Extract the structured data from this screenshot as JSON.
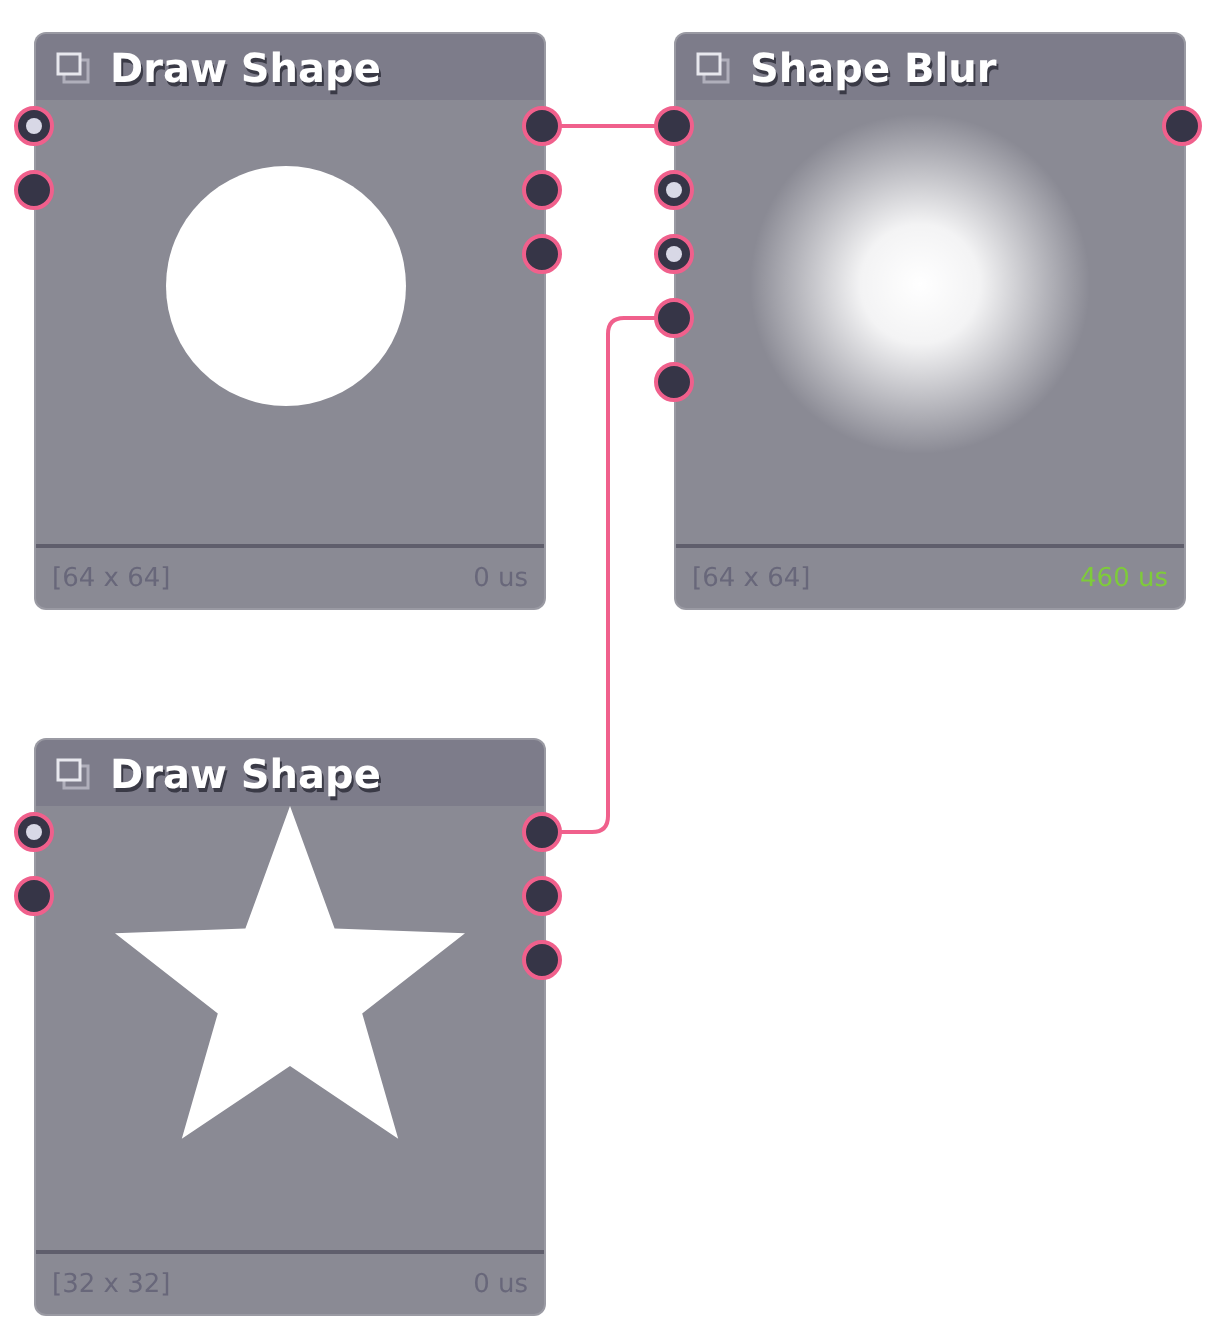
{
  "nodes": [
    {
      "title": "Draw Shape",
      "kind": "circle",
      "inputs": [
        {
          "filled": true,
          "connected": false
        },
        {
          "filled": false,
          "connected": false
        }
      ],
      "outputs": [
        {
          "filled": false,
          "connected": true
        },
        {
          "filled": false,
          "connected": false
        },
        {
          "filled": false,
          "connected": false
        }
      ],
      "size": "[64 x 64]",
      "time": "0 us",
      "time_highlighted": false
    },
    {
      "title": "Shape Blur",
      "kind": "blur",
      "inputs": [
        {
          "filled": false,
          "connected": true
        },
        {
          "filled": true,
          "connected": false
        },
        {
          "filled": true,
          "connected": false
        },
        {
          "filled": false,
          "connected": true
        },
        {
          "filled": false,
          "connected": false
        }
      ],
      "outputs": [
        {
          "filled": false,
          "connected": false
        }
      ],
      "size": "[64 x 64]",
      "time": "460 us",
      "time_highlighted": true
    },
    {
      "title": "Draw Shape",
      "kind": "star",
      "inputs": [
        {
          "filled": true,
          "connected": false
        },
        {
          "filled": false,
          "connected": false
        }
      ],
      "outputs": [
        {
          "filled": false,
          "connected": true
        },
        {
          "filled": false,
          "connected": false
        },
        {
          "filled": false,
          "connected": false
        }
      ],
      "size": "[32 x 32]",
      "time": "0 us",
      "time_highlighted": false
    }
  ]
}
